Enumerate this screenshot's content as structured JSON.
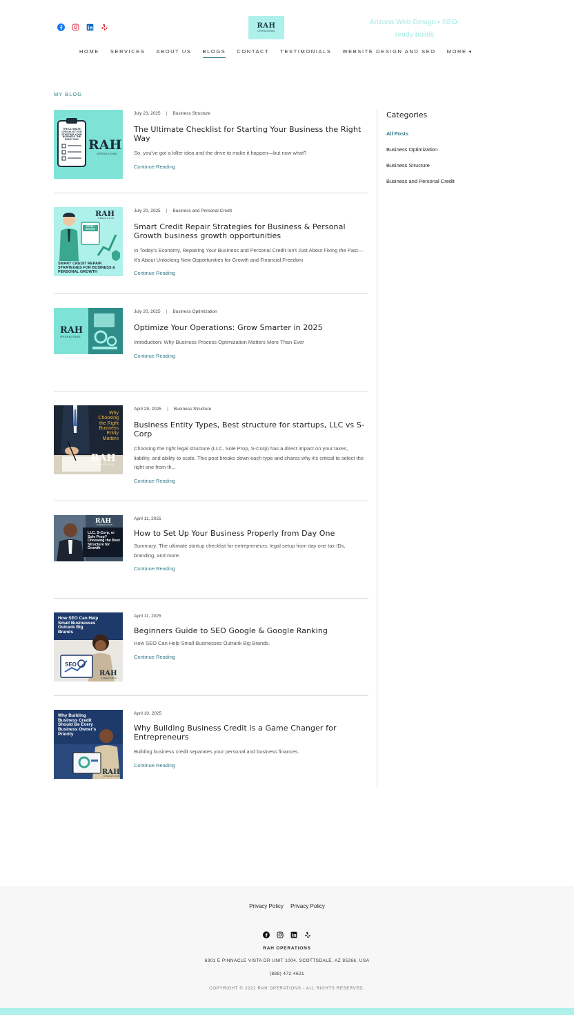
{
  "header": {
    "logo": {
      "brand": "RAH",
      "sub": "OPERATIONS"
    },
    "tagline": "Arizona Web Design • SEO-ready builds",
    "social_icons": [
      "facebook-icon",
      "instagram-icon",
      "linkedin-icon",
      "yelp-icon"
    ]
  },
  "nav": {
    "items": [
      {
        "label": "HOME",
        "active": false
      },
      {
        "label": "SERVICES",
        "active": false
      },
      {
        "label": "ABOUT US",
        "active": false
      },
      {
        "label": "BLOGS",
        "active": true
      },
      {
        "label": "CONTACT",
        "active": false
      },
      {
        "label": "TESTIMONIALS",
        "active": false
      },
      {
        "label": "WEBSITE DESIGN AND SEO",
        "active": false
      },
      {
        "label": "MORE",
        "active": false
      }
    ]
  },
  "page": {
    "label": "MY BLOG"
  },
  "posts": [
    {
      "date": "July 23, 2025",
      "category": "Business Structure",
      "title": "The Ultimate Checklist for Starting Your Business the Right Way",
      "excerpt": "So, you've got a killer idea and the drive to make it happen—but now what?",
      "read_more": "Continue Reading",
      "thumb": {
        "text": "THE ULTIMATE CHECKLIST FOR STARTING YOUR BUSINESS THE RIGHT WAY",
        "brand": "RAH",
        "sub": "OPERATIONS"
      }
    },
    {
      "date": "July 20, 2025",
      "category": "Business and Personal Credit",
      "title": "Smart Credit Repair Strategies for Business & Personal Growth business growth opportunities",
      "excerpt": "In Today's Economy, Repairing Your Business and Personal Credit Isn't Just About Fixing the Past—It's About Unlocking New Opportunities for Growth and Financial Freedom",
      "read_more": "Continue Reading",
      "thumb": {
        "text": "SMART CREDIT REPAIR STRATEGIES FOR BUSINESS & PERSONAL GROWTH",
        "badge": "CREDIT REPORT",
        "brand": "RAH",
        "sub": "OPERATIONS"
      }
    },
    {
      "date": "July 20, 2025",
      "category": "Business Optimization",
      "title": "Optimize Your Operations: Grow Smarter in 2025",
      "excerpt": "Introduction: Why Business Process Optimization Matters More Than Ever",
      "read_more": "Continue Reading",
      "thumb": {
        "brand": "RAH",
        "sub": "OPERATIONS"
      }
    },
    {
      "date": "April 29, 2025",
      "category": "Business Structure",
      "title": "Business Entity Types, Best structure for startups, LLC vs S-Corp",
      "excerpt": "Choosing the right legal structure (LLC, Sole Prop, S-Corp) has a direct impact on your taxes, liability, and ability to scale. This post breaks down each type and shares why it's critical to select the right one from th...",
      "read_more": "Continue Reading",
      "thumb": {
        "text": "Why Choosing the Right Business Entity Matters",
        "brand": "RAH",
        "sub": "OPERATIONS"
      }
    },
    {
      "date": "April 11, 2025",
      "category": "",
      "title": "How to Set Up Your Business Properly from Day One",
      "excerpt": "Summary: The ultimate startup checklist for entrepreneurs: legal setup from day one tax IDs, branding, and more.",
      "read_more": "Continue Reading",
      "thumb": {
        "text": "LLC, S-Corp, or Sole Prop? Choosing the Best Structure for Growth",
        "brand": "RAH",
        "sub": "OPERATIONS"
      }
    },
    {
      "date": "April 11, 2025",
      "category": "",
      "title": "Beginners Guide to SEO Google & Google Ranking",
      "excerpt": "How SEO Can Help Small Businesses Outrank Big Brands.",
      "read_more": "Continue Reading",
      "thumb": {
        "text": "How SEO Can Help Small Businesses Outrank Big Brands",
        "badge": "SEO",
        "brand": "RAH",
        "sub": "OPERATIONS"
      }
    },
    {
      "date": "April 10, 2025",
      "category": "",
      "title": "Why Building Business Credit is a Game Changer for Entrepreneurs",
      "excerpt": "Building business credit separates your personal and business finances.",
      "read_more": "Continue Reading",
      "thumb": {
        "text": "Why Building Business Credit Should Be Every Business Owner's Priority",
        "brand": "RAH",
        "sub": "OPERATIONS"
      }
    }
  ],
  "sidebar": {
    "title": "Categories",
    "items": [
      {
        "label": "All Posts",
        "active": true
      },
      {
        "label": "Business Optimization",
        "active": false
      },
      {
        "label": "Business Structure",
        "active": false
      },
      {
        "label": "Business and Personal Credit",
        "active": false
      }
    ]
  },
  "footer": {
    "links": [
      "Privacy Policy",
      "Privacy Policy"
    ],
    "social_icons": [
      "facebook-icon",
      "instagram-icon",
      "linkedin-icon",
      "yelp-icon"
    ],
    "company": "RAH OPERATIONS",
    "address": "6301 E PINNACLE VISTA DR UNIT 1004, SCOTTSDALE, AZ 85266, USA",
    "phone": "(888) 472-4621",
    "copyright": "COPYRIGHT © 2022 RAH OPERATIONS - ALL RIGHTS RESERVED."
  },
  "colors": {
    "accent": "#2f7a88",
    "brand_mint": "#aef0ea",
    "thumb_mint": "#7ee3d6",
    "tagline": "#a3e9e3",
    "facebook": "#1877f2",
    "instagram": "#e4405f",
    "linkedin": "#0a66c2",
    "yelp": "#d32323"
  }
}
